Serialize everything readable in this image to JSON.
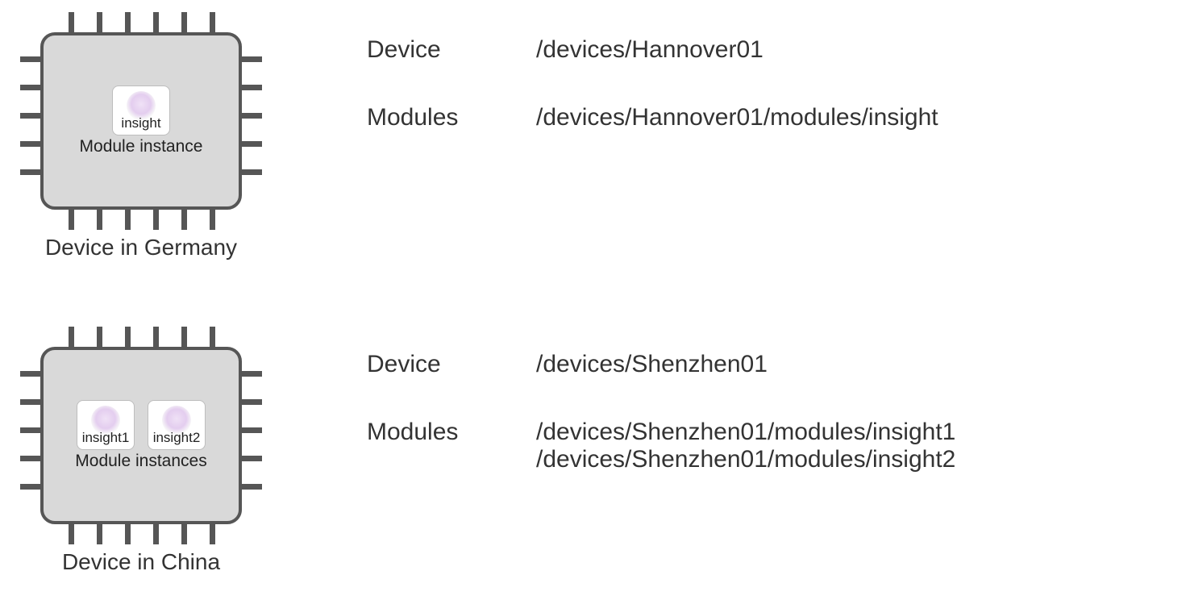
{
  "devices": [
    {
      "id": "germany",
      "chip_caption": "Device in Germany",
      "module_caption": "Module instance",
      "modules": [
        {
          "name": "insight"
        }
      ],
      "info": {
        "device_label": "Device",
        "device_path": "/devices/Hannover01",
        "modules_label": "Modules",
        "modules_paths": "/devices/Hannover01/modules/insight"
      }
    },
    {
      "id": "china",
      "chip_caption": "Device in China",
      "module_caption": "Module instances",
      "modules": [
        {
          "name": "insight1"
        },
        {
          "name": "insight2"
        }
      ],
      "info": {
        "device_label": "Device",
        "device_path": "/devices/Shenzhen01",
        "modules_label": "Modules",
        "modules_paths": "/devices/Shenzhen01/modules/insight1\n/devices/Shenzhen01/modules/insight2"
      }
    }
  ]
}
